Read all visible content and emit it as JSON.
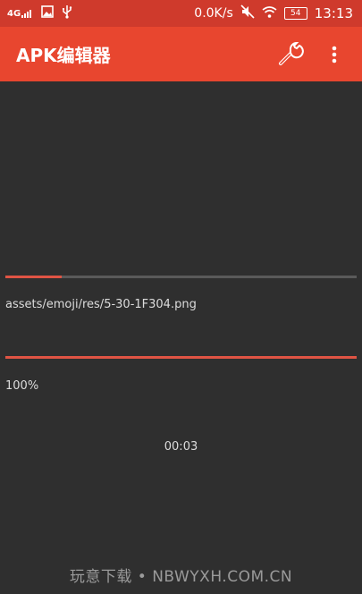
{
  "status_bar": {
    "network": "4G",
    "net_speed": "0.0K/s",
    "battery": "54",
    "time": "13:13",
    "icons": [
      "signal-icon",
      "image-icon",
      "usb-icon",
      "mute-icon",
      "wifi-icon",
      "battery-icon"
    ]
  },
  "toolbar": {
    "title": "APK编辑器",
    "actions": [
      "wrench-icon",
      "more-vert-icon"
    ]
  },
  "progress": {
    "current_file_fraction": 0.16,
    "current_file": "assets/emoji/res/5-30-1F304.png",
    "overall_fraction": 1.0,
    "overall_percent": "100%",
    "elapsed": "00:03"
  },
  "watermark": "玩意下载 • NBWYXH.COM.CN",
  "colors": {
    "status_bar": "#cf3a2c",
    "toolbar": "#e8462f",
    "background": "#2f2f2f",
    "progress_fill": "#e05444",
    "progress_track": "#5a5a5a"
  }
}
